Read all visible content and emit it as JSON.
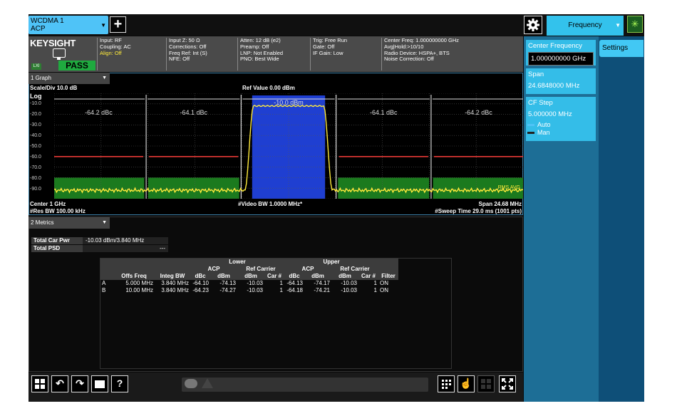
{
  "mode_tab": {
    "line1": "WCDMA 1",
    "line2": "ACP",
    "arrow": "▼"
  },
  "add_button_label": "+",
  "brand": "KEYSIGHT",
  "lxi_badge": "LXI",
  "pass_label": "PASS",
  "status": {
    "col1": [
      "Input: RF",
      "Coupling: AC",
      "Align: Off"
    ],
    "col2": [
      "Input Z: 50 Ω",
      "Corrections: Off",
      "Freq Ref: Int (S)",
      "NFE: Off"
    ],
    "col3": [
      "Atten: 12 dB (e2)",
      "Preamp: Off",
      "LNP: Not Enabled",
      "PNO: Best Wide"
    ],
    "col4": [
      "Trig: Free Run",
      "Gate: Off",
      "IF Gain: Low"
    ],
    "col5": [
      "Center Freq: 1.000000000 GHz",
      "Avg|Hold:>10/10",
      "Radio Device: HSPA+, BTS",
      "Noise Correction: Off"
    ]
  },
  "right_panel": {
    "menu_title": "Frequency",
    "menu_arrow": "▼",
    "settings_tab": "Settings",
    "center_freq": {
      "label": "Center Frequency",
      "value": "1.000000000 GHz"
    },
    "span": {
      "label": "Span",
      "value": "24.6848000 MHz"
    },
    "cf_step": {
      "label": "CF Step",
      "value": "5.000000 MHz"
    },
    "auto_label": "Auto",
    "man_label": "Man"
  },
  "graph": {
    "title": "1 Graph",
    "scale": "Scale/Div 10.0 dB",
    "ref": "Ref Value 0.00 dBm",
    "log": "Log",
    "yticks": [
      "-10.0",
      "-20.0",
      "-30.0",
      "-40.0",
      "-50.0",
      "-60.0",
      "-70.0",
      "-80.0",
      "-90.0"
    ],
    "rms_avg": "RMS AVG",
    "bottom_left_1": "Center 1 GHz",
    "bottom_left_2": "#Res BW 100.00 kHz",
    "bottom_center": "#Video BW 1.0000 MHz*",
    "bottom_right_1": "Span 24.68 MHz",
    "bottom_right_2": "#Sweep Time 29.0 ms (1001 pts)"
  },
  "colors": {
    "carrier": "#1f3fd1",
    "trace": "#ffeb3b",
    "limit": "#e53935",
    "fill": "#1b7a1e"
  },
  "chart_data": {
    "type": "line",
    "title": "",
    "ylabel": "dBm",
    "ylim": [
      -100,
      0
    ],
    "xlim": [
      987.6576,
      1012.3424
    ],
    "ref_level_dbm": 0.0,
    "scale_div_db": 10.0,
    "center_freq_ghz": 1.0,
    "span_mhz": 24.68,
    "grid": true,
    "bands": [
      {
        "name": "B lower",
        "offset_mhz": -10,
        "label": "-64.2 dBc",
        "level_dbm": -74.27
      },
      {
        "name": "A lower",
        "offset_mhz": -5,
        "label": "-64.1 dBc",
        "level_dbm": -74.13
      },
      {
        "name": "Carrier",
        "offset_mhz": 0,
        "label": "-10.0 dBm",
        "level_dbm": -10.03
      },
      {
        "name": "A upper",
        "offset_mhz": 5,
        "label": "-64.1 dBc",
        "level_dbm": -74.17
      },
      {
        "name": "B upper",
        "offset_mhz": 10,
        "label": "-64.2 dBc",
        "level_dbm": -74.21
      }
    ],
    "limit_line_dbm": -60,
    "noise_floor_dbm": -92,
    "carrier_top_dbm": -12
  },
  "metrics": {
    "title": "2 Metrics",
    "total_car_pwr_label": "Total Car Pwr",
    "total_car_pwr_value": "-10.03 dBm/3.840 MHz",
    "total_psd_label": "Total PSD",
    "total_psd_value": "---",
    "table": {
      "group_lower": "Lower",
      "group_upper": "Upper",
      "acp": "ACP",
      "ref_carrier": "Ref Carrier",
      "cols": [
        "Offs Freq",
        "Integ BW",
        "dBc",
        "dBm",
        "dBm",
        "Car #",
        "dBc",
        "dBm",
        "dBm",
        "Car #",
        "Filter"
      ],
      "rows": [
        {
          "id": "A",
          "cells": [
            "5.000 MHz",
            "3.840 MHz",
            "-64.10",
            "-74.13",
            "-10.03",
            "1",
            "-64.13",
            "-74.17",
            "-10.03",
            "1",
            "ON"
          ]
        },
        {
          "id": "B",
          "cells": [
            "10.00 MHz",
            "3.840 MHz",
            "-64.23",
            "-74.27",
            "-10.03",
            "1",
            "-64.18",
            "-74.21",
            "-10.03",
            "1",
            "ON"
          ]
        }
      ]
    }
  },
  "toolbar": {
    "help_label": "?"
  }
}
